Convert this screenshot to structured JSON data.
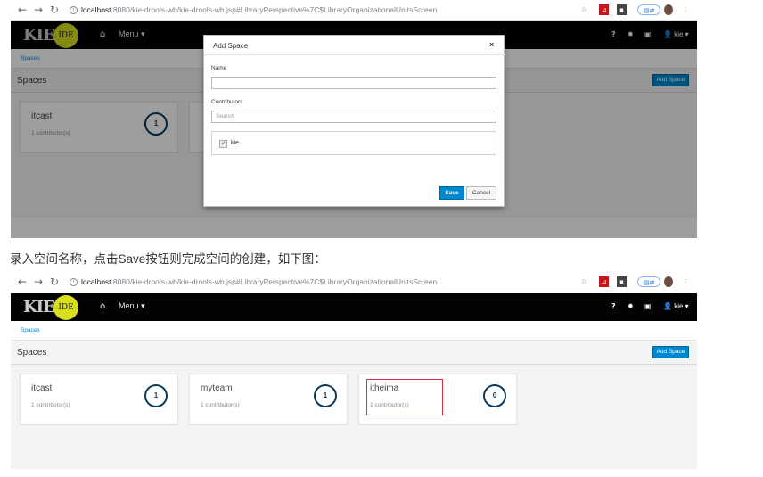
{
  "browser": {
    "url_host": "localhost",
    "url_path": ":8080/kie-drools-wb/kie-drools-wb.jsp#LibraryPerspective%7C$LibraryOrganizationalUnitsScreen",
    "back_icon": "arrow-left-icon",
    "forward_icon": "arrow-right-icon",
    "reload_icon": "reload-icon"
  },
  "app": {
    "logo_text": "KIE",
    "logo_badge": "IDE",
    "menu_label": "Menu",
    "help_glyph": "?",
    "user_label": "kie",
    "accent": "#0088ce",
    "appbar_color": "#030303",
    "logo_badge_color": "#d8df1f"
  },
  "breadcrumb": "Spaces",
  "page_title": "Spaces",
  "add_space_label": "Add Space",
  "shot1": {
    "cards": [
      {
        "name": "itcast",
        "contributors": "1 contributor(s)",
        "count": "1"
      }
    ],
    "modal": {
      "title": "Add Space",
      "close_glyph": "×",
      "name_label": "Name",
      "name_value": "",
      "contributors_label": "Contributors",
      "search_placeholder": "Search",
      "contributor_user": "kie",
      "save_label": "Save",
      "cancel_label": "Cancel"
    }
  },
  "caption": "录入空间名称，点击Save按钮则完成空间的创建，如下图：",
  "shot2": {
    "cards": [
      {
        "name": "itcast",
        "contributors": "1 contributor(s)",
        "count": "1"
      },
      {
        "name": "myteam",
        "contributors": "1 contributor(s)",
        "count": "1"
      },
      {
        "name": "itheima",
        "contributors": "1 contributor(s)",
        "count": "0"
      }
    ],
    "highlight_color": "#d9303d"
  }
}
